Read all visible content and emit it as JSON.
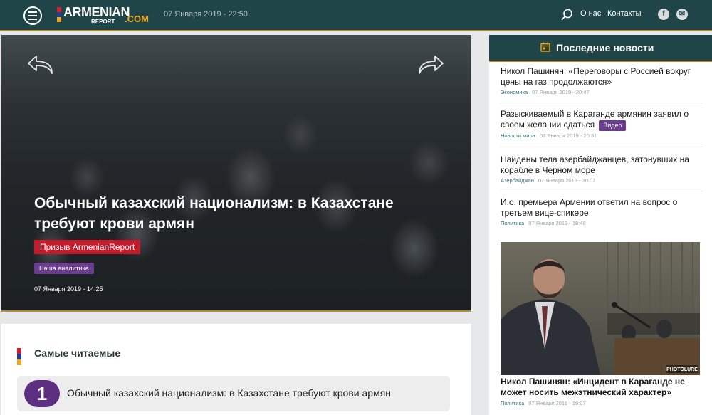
{
  "header": {
    "logo_main": "ARMENIAN",
    "logo_sub": "REPORT",
    "logo_com": ".COM",
    "datetime": "07 Января 2019 - 22:50",
    "nav": [
      "О нас",
      "Контакты"
    ],
    "social": [
      "f",
      "✉"
    ]
  },
  "hero": {
    "title": "Обычный казахский национализм: в Казахстане требуют крови армян",
    "badge_red": "Призыв ArmenianReport",
    "badge_purple": "Наша аналитика",
    "date": "07 Января 2019 - 14:25"
  },
  "most_read": {
    "title": "Самые читаемые",
    "items": [
      {
        "rank": "1",
        "title": "Обычный казахский национализм: в Казахстане требуют крови армян"
      }
    ]
  },
  "sidebar": {
    "title": "Последние новости",
    "news": [
      {
        "title": "Никол Пашинян: «Переговоры с Россией вокруг цены на газ продолжаются»",
        "category": "Экономика",
        "date": "07 Января 2019 - 20:47"
      },
      {
        "title": "Разыскиваемый в Караганде армянин заявил о своем желании сдаться",
        "tag": "Видео",
        "category": "Новости мира",
        "date": "07 Января 2019 - 20:31"
      },
      {
        "title": "Найдены тела азербайджанцев, затонувших на корабле в Черном море",
        "category": "Азербайджан",
        "date": "07 Января 2019 - 20:07"
      },
      {
        "title": "И.о. премьера Армении ответил на вопрос о третьем вице-спикере",
        "category": "Политика",
        "date": "07 Января 2019 - 19:48"
      }
    ],
    "featured": {
      "title": "Никол Пашинян: «Инцидент в Караганде не может носить межэтнический характер»",
      "category": "Политика",
      "date": "07 Января 2019 - 19:07",
      "watermark": "PHOTOLURE"
    }
  },
  "colors": {
    "header_bg": "#1f4549",
    "accent_gold": "#b48a36",
    "badge_red": "#c21c2d",
    "badge_purple": "#6b3d8f",
    "rank_purple": "#5c2f80",
    "meta_teal": "#3b6f74",
    "flag": [
      "#d81e2c",
      "#1f3f95",
      "#f2a81c"
    ]
  },
  "icons": [
    "menu-icon",
    "search-icon",
    "facebook-icon",
    "telegram-icon",
    "arrow-left-icon",
    "arrow-right-icon",
    "calendar-icon",
    "armenian-flag-icon"
  ]
}
